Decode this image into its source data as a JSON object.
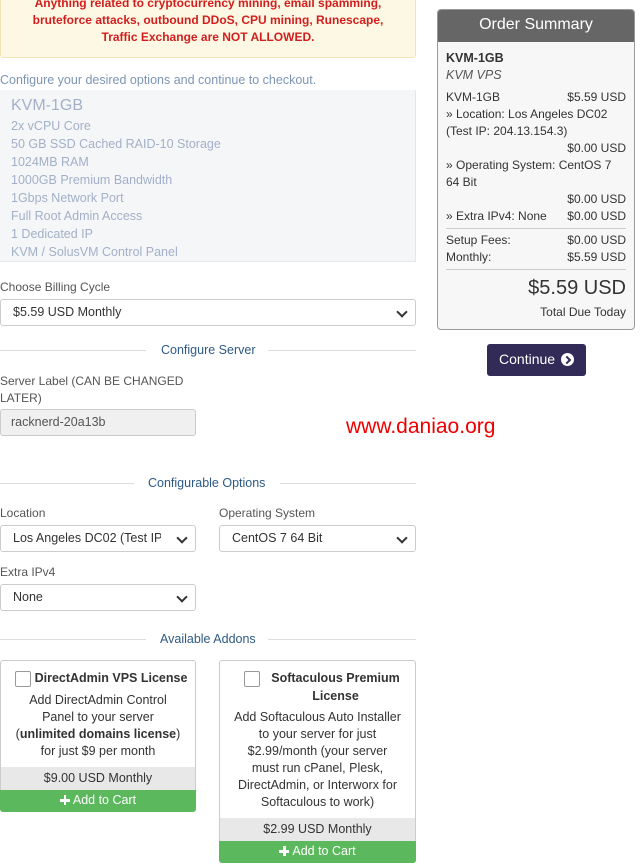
{
  "warning": {
    "lines": [
      "Anything related to cryptocurrency mining, email spamming,",
      "bruteforce attacks, outbound DDoS, CPU mining, Runescape,",
      "Traffic Exchange are NOT ALLOWED."
    ]
  },
  "intro": "Configure your desired options and continue to checkout.",
  "product": {
    "name": "KVM-1GB",
    "features": [
      "2x vCPU Core",
      "50 GB SSD Cached RAID-10 Storage",
      "1024MB RAM",
      "1000GB Premium Bandwidth",
      "1Gbps Network Port",
      "Full Root Admin Access",
      "1 Dedicated IP",
      "KVM / SolusVM Control Panel"
    ]
  },
  "billing": {
    "label": "Choose Billing Cycle",
    "selected": "$5.59 USD Monthly"
  },
  "configure_server": {
    "title": "Configure Server",
    "label_line1": "Server Label (CAN BE CHANGED",
    "label_line2": "LATER)",
    "value": "racknerd-20a13b"
  },
  "watermark": "www.daniao.org",
  "configurable_options": {
    "title": "Configurable Options",
    "location_label": "Location",
    "location_value": "Los Angeles DC02 (Test IP: 204.13.154.3)",
    "os_label": "Operating System",
    "os_value": "CentOS 7 64 Bit",
    "ipv4_label": "Extra IPv4",
    "ipv4_value": "None"
  },
  "addons": {
    "title": "Available Addons",
    "items": [
      {
        "name": "DirectAdmin VPS License",
        "desc1": "Add DirectAdmin Control",
        "desc2": "Panel to your server",
        "desc3_open": "(",
        "desc3_bold": "unlimited domains license",
        "desc3_close": ")",
        "desc4": "for just $9 per month",
        "price": "$9.00 USD Monthly",
        "cart": "Add to Cart"
      },
      {
        "name_line1": "Softaculous Premium",
        "name_line2": "License",
        "desc": [
          "Add Softaculous Auto Installer",
          "to your server for just",
          "$2.99/month (your server",
          "must run cPanel, Plesk,",
          "DirectAdmin, or Interworx for",
          "Softaculous to work)"
        ],
        "price": "$2.99 USD Monthly",
        "cart": "Add to Cart"
      }
    ]
  },
  "summary": {
    "title": "Order Summary",
    "product_name": "KVM-1GB",
    "product_group": "KVM VPS",
    "line_product": "KVM-1GB",
    "line_product_price": "$5.59 USD",
    "location_line1": "» Location: Los Angeles DC02",
    "location_line2": "(Test IP: 204.13.154.3)",
    "location_price": "$0.00 USD",
    "os_line1": "» Operating System: CentOS 7",
    "os_line2": "64 Bit",
    "os_price": "$0.00 USD",
    "ipv4_line": "» Extra IPv4: None",
    "ipv4_price": "$0.00 USD",
    "setup_label": "Setup Fees:",
    "setup_value": "$0.00 USD",
    "monthly_label": "Monthly:",
    "monthly_value": "$5.59 USD",
    "total": "$5.59 USD",
    "total_label": "Total Due Today"
  },
  "continue_label": "Continue"
}
